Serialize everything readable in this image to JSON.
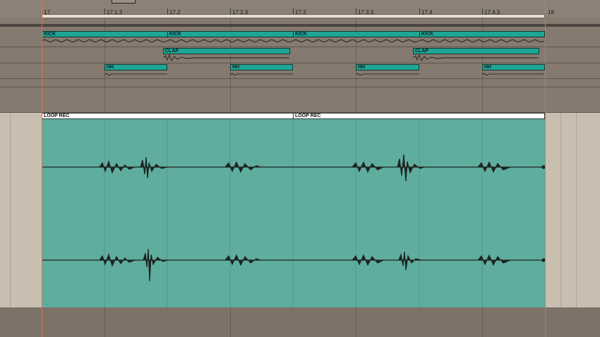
{
  "ruler": {
    "ticks": [
      "17",
      "17.1.3",
      "17.2",
      "17.2.3",
      "17.3",
      "17.3.3",
      "17.4",
      "17.4.3",
      "18"
    ]
  },
  "tracks": {
    "kick": [
      "KICK",
      "KICK",
      "KICK",
      "KICK"
    ],
    "clap": [
      "CLAP",
      "CLAP"
    ],
    "hh": [
      "HH",
      "HH",
      "HH",
      "HH"
    ]
  },
  "detail": {
    "clips": [
      "LOOP REC",
      "LOOP REC"
    ]
  },
  "colors": {
    "clip": "#1fa595",
    "waveform_bg": "#5fad9f",
    "loop_marker": "#e0704a"
  }
}
